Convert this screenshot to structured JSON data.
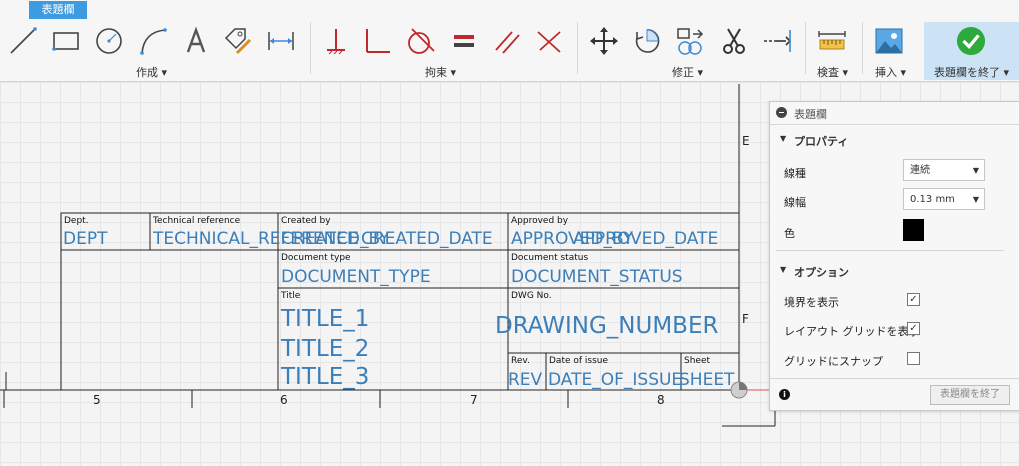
{
  "context_tab": "表題欄",
  "ribbon": {
    "groups": {
      "create": "作成 ▾",
      "constrain": "拘束 ▾",
      "modify": "修正 ▾",
      "inspect": "検査 ▾",
      "insert": "挿入 ▾",
      "finish": "表題欄を終了 ▾"
    }
  },
  "title_block": {
    "labels": {
      "dept": "Dept.",
      "technical_reference": "Technical reference",
      "created_by": "Created by",
      "approved_by": "Approved by",
      "document_type": "Document type",
      "document_status": "Document status",
      "title": "Title",
      "dwg_no": "DWG No.",
      "rev": "Rev.",
      "date_of_issue": "Date of issue",
      "sheet": "Sheet"
    },
    "values": {
      "dept": "DEPT",
      "technical_reference": "TECHNICAL_REFERENCE",
      "created_by": "CREATED_BY",
      "created_date": "CREATED_DATE",
      "approved_by": "APPROVED_BY",
      "approved_date": "APPROVED_DATE",
      "document_type": "DOCUMENT_TYPE",
      "document_status": "DOCUMENT_STATUS",
      "title_1": "TITLE_1",
      "title_2": "TITLE_2",
      "title_3": "TITLE_3",
      "drawing_number": "DRAWING_NUMBER",
      "rev": "REV",
      "date_of_issue": "DATE_OF_ISSUE",
      "sheet": "SHEET"
    }
  },
  "border": {
    "column_numbers": [
      "5",
      "6",
      "7",
      "8"
    ],
    "row_letters": [
      "E",
      "F"
    ]
  },
  "panel": {
    "title": "表題欄",
    "properties": {
      "heading": "プロパティ",
      "line_type_label": "線種",
      "line_type_value": "連続",
      "line_weight_label": "線幅",
      "line_weight_value": "0.13 mm",
      "color_label": "色",
      "color_value": "#000000"
    },
    "options": {
      "heading": "オプション",
      "show_border": "境界を表示",
      "show_border_checked": true,
      "show_layout_grid": "レイアウト グリッドを表示",
      "show_layout_grid_checked": true,
      "snap_to_grid": "グリッドにスナップ",
      "snap_to_grid_checked": false
    },
    "finish_button": "表題欄を終了"
  }
}
